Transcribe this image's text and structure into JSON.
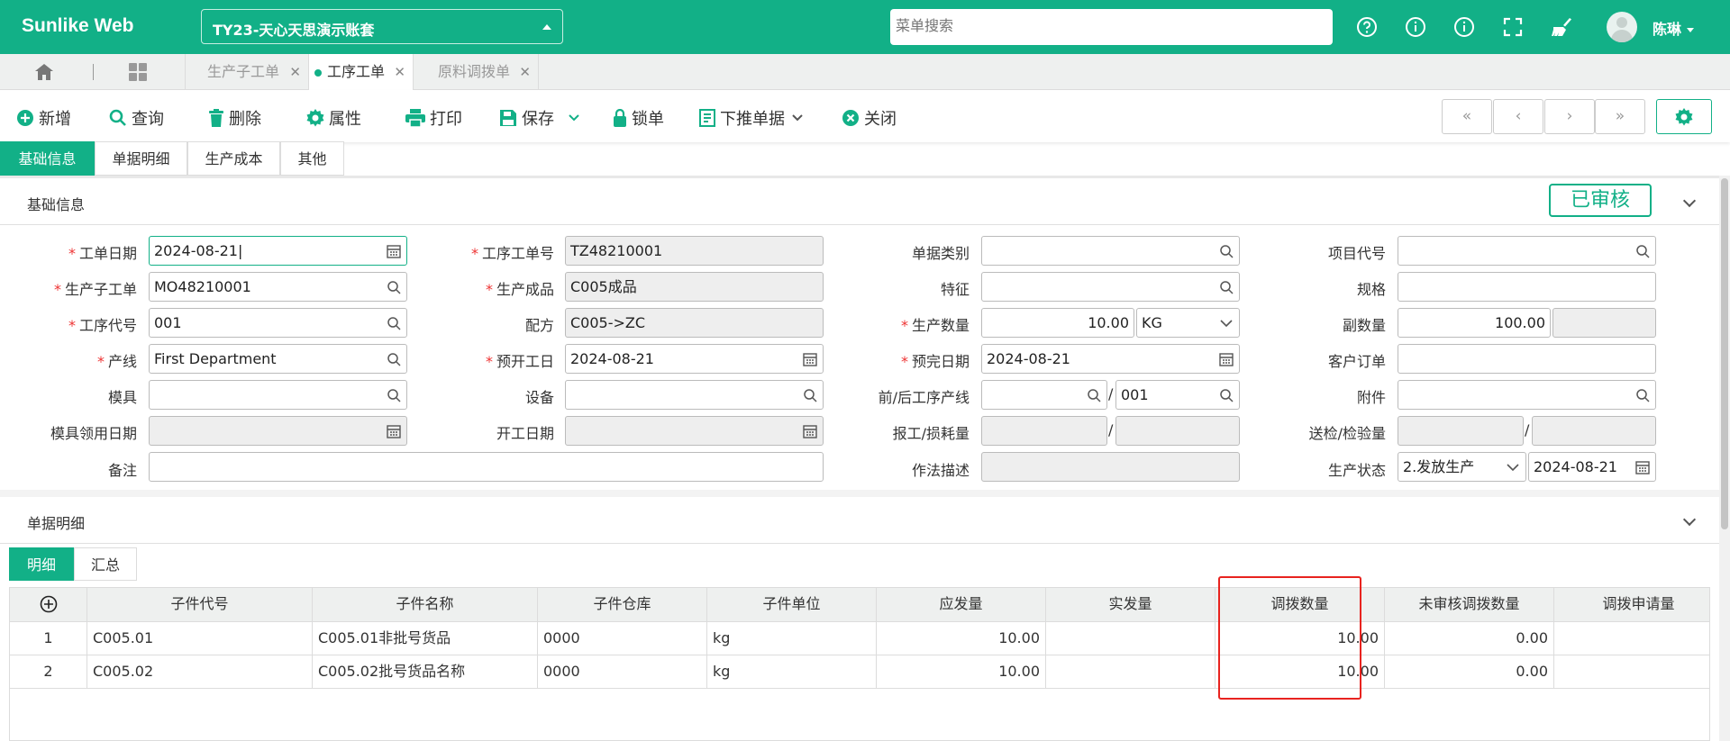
{
  "app": {
    "name": "Sunlike Web"
  },
  "header": {
    "account": "TY23-天心天思演示账套",
    "menu_search_placeholder": "菜单搜索",
    "user": "陈琳"
  },
  "tabs": [
    {
      "label": "生产子工单"
    },
    {
      "label": "工序工单"
    },
    {
      "label": "原料调拨单"
    }
  ],
  "toolbar": {
    "new": "新增",
    "query": "查询",
    "delete": "删除",
    "props": "属性",
    "print": "打印",
    "save": "保存",
    "lock": "锁单",
    "push_down": "下推单据",
    "close": "关闭"
  },
  "pager": {
    "first": "«",
    "prev": "‹",
    "next": "›",
    "last": "»"
  },
  "form_tabs": [
    "基础信息",
    "单据明细",
    "生产成本",
    "其他"
  ],
  "basic": {
    "section_title": "基础信息",
    "status_stamp": "已审核",
    "labels": {
      "order_date": "工单日期",
      "proc_order_no": "工序工单号",
      "doc_type": "单据类别",
      "project_code": "项目代号",
      "sub_order": "生产子工单",
      "product": "生产成品",
      "feature": "特征",
      "spec": "规格",
      "proc_code": "工序代号",
      "formula": "配方",
      "qty": "生产数量",
      "sub_qty": "副数量",
      "line": "产线",
      "plan_start": "预开工日",
      "plan_finish": "预完日期",
      "customer_order": "客户订单",
      "mold": "模具",
      "equipment": "设备",
      "prev_next_line": "前/后工序产线",
      "attachment": "附件",
      "mold_use_date": "模具领用日期",
      "start_date": "开工日期",
      "report_loss": "报工/损耗量",
      "inspect_qty": "送检/检验量",
      "remark": "备注",
      "method_desc": "作法描述",
      "prod_status": "生产状态"
    },
    "values": {
      "order_date": "2024-08-21",
      "proc_order_no": "TZ48210001",
      "sub_order": "MO48210001",
      "product": "C005成品",
      "proc_code": "001",
      "formula": "C005->ZC",
      "qty": "10.00",
      "unit": "KG",
      "sub_qty": "100.00",
      "line": "First Department",
      "plan_start": "2024-08-21",
      "plan_finish": "2024-08-21",
      "next_line": "001",
      "prod_status": "2.发放生产",
      "status_date": "2024-08-21"
    },
    "slash": "/"
  },
  "detail": {
    "section_title": "单据明细",
    "tabs": [
      "明细",
      "汇总"
    ],
    "columns": [
      "子件代号",
      "子件名称",
      "子件仓库",
      "子件单位",
      "应发量",
      "实发量",
      "调拨数量",
      "未审核调拨数量",
      "调拨申请量"
    ],
    "rows": [
      {
        "no": "1",
        "code": "C005.01",
        "name": "C005.01非批号货品",
        "wh": "0000",
        "unit": "kg",
        "due": "10.00",
        "actual": "",
        "transfer": "10.00",
        "unaudited": "0.00",
        "apply": ""
      },
      {
        "no": "2",
        "code": "C005.02",
        "name": "C005.02批号货品名称",
        "wh": "0000",
        "unit": "kg",
        "due": "10.00",
        "actual": "",
        "transfer": "10.00",
        "unaudited": "0.00",
        "apply": ""
      }
    ]
  }
}
